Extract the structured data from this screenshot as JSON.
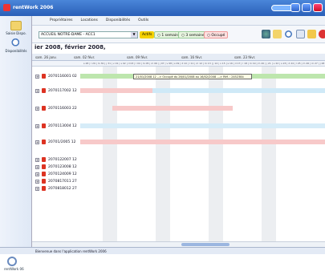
{
  "window": {
    "title": "rentWork 2006"
  },
  "sidebar": {
    "items": [
      {
        "label": "Saisie Dispo.",
        "icon": "grid-icon"
      },
      {
        "label": "Disponibilités",
        "icon": "magnifier-icon"
      }
    ],
    "footer_label": "rentWork 06"
  },
  "menu": [
    "Propriétaires",
    "Locations",
    "Disponibilités",
    "Outils"
  ],
  "toolbar": {
    "select_value": "ACCUEIL NOTRE-DAME - ACC1",
    "chips": [
      {
        "label": "Actifs",
        "color": "#f6d200"
      },
      {
        "label": "1 semaine",
        "color": "#e8f5e0"
      },
      {
        "label": "3 semaines",
        "color": "#e8f5e0"
      },
      {
        "label": "Occupé",
        "color": "#fde0e0"
      }
    ]
  },
  "period": {
    "label": "ier 2008,  février 2008,"
  },
  "weeks": [
    "sam. 26 janv.",
    "sam. 02 févr.",
    "sam. 09 févr.",
    "sam. 16 févr.",
    "sam. 23 févr."
  ],
  "days_line": "s 28 | l 29 | m 30 | j 31 | v 01 | s 02 | d 03 | l 04 | m 05 | m 06 | j 07 | v 08 | s 09 | d 10 | l 11 | m 12 | m 13 | j 14 | v 15 | s 16 | d 17 | l 18 | m 19 | m 20 | j 21 | v 22 | s 23 | d 24 | l 25 | m 26 | m 27 | j 28",
  "rows": [
    {
      "label": "2070116001 02",
      "color": "#9fd68a"
    },
    {
      "label": "2070117002 12",
      "color": "#f3a6a6"
    },
    {
      "label": "2070116003 22",
      "color": "#f3a6a6"
    },
    {
      "label": "2070113004 12",
      "color": "#a8d5f0"
    },
    {
      "label": "20701/2005 12",
      "color": "#f3a6a6"
    },
    {
      "label": "2070122007 12",
      "color": "#9fd68a"
    },
    {
      "label": "2070123008 12",
      "color": "#a8d5f0"
    },
    {
      "label": "2070124009 12",
      "color": "#a8d5f0"
    },
    {
      "label": "2070817011 27",
      "color": "#f3a6a6"
    },
    {
      "label": "2070818012 27",
      "color": "#9fd68a"
    }
  ],
  "tooltip": "21/01/2008 12 --> Occupé du 26/01/2008 au 16/02/2008 ---> Réf. : 2452384",
  "status": {
    "text": "Bienvenue dans l'application rentWork 2006"
  }
}
